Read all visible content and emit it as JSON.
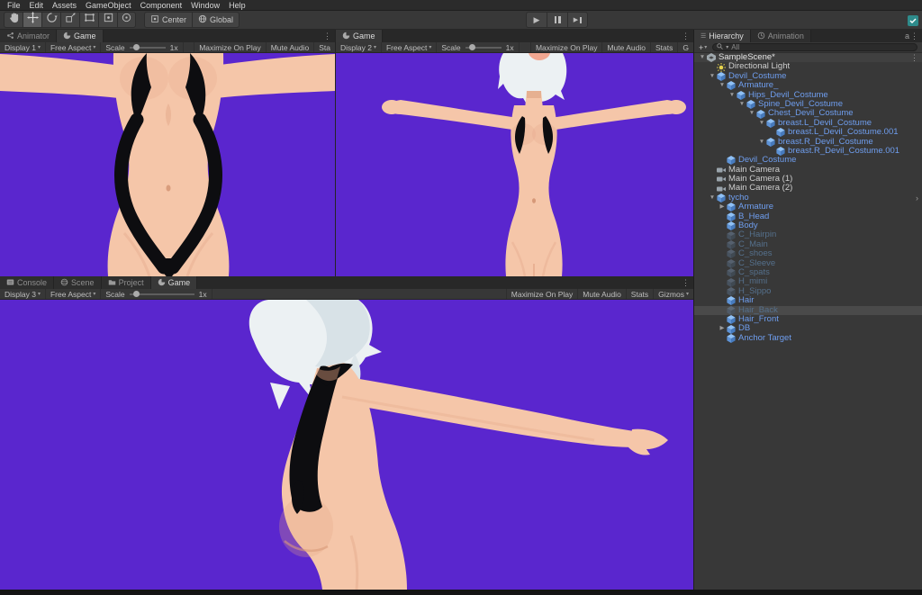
{
  "colors": {
    "viewport_bg": "#5A26CE",
    "skin": "#F5C6A9",
    "skin_shade": "#E2A486",
    "hair": "#ECF1F3",
    "costume": "#0D0D10",
    "prefab_blue": "#6F9EEF",
    "disabled_item": "#55708C",
    "selection_row": "#4A4A4A"
  },
  "icons": {
    "kebab": "⋮",
    "caret": "▾",
    "arrow_open": "▼",
    "arrow_closed": "▶",
    "plus": "+",
    "play": "▶",
    "chevron": "›",
    "hamburger": "☰"
  },
  "menu_bar": {
    "items": [
      "File",
      "Edit",
      "Assets",
      "GameObject",
      "Component",
      "Window",
      "Help"
    ]
  },
  "toolbar": {
    "center_label": "Center",
    "global_label": "Global"
  },
  "panel1": {
    "tab_animator": "Animator",
    "tab_game": "Game",
    "display": "Display 1",
    "aspect": "Free Aspect",
    "scale_label": "Scale",
    "scale_value": "1x",
    "maximize": "Maximize On Play",
    "mute": "Mute Audio",
    "stats": "Sta"
  },
  "panel2": {
    "tab_game": "Game",
    "display": "Display 2",
    "aspect": "Free Aspect",
    "scale_label": "Scale",
    "scale_value": "1x",
    "maximize": "Maximize On Play",
    "mute": "Mute Audio",
    "stats": "Stats",
    "gizmos": "G"
  },
  "panel3": {
    "tab_console": "Console",
    "tab_scene": "Scene",
    "tab_project": "Project",
    "tab_game": "Game",
    "display": "Display 3",
    "aspect": "Free Aspect",
    "scale_label": "Scale",
    "scale_value": "1x",
    "maximize": "Maximize On Play",
    "mute": "Mute Audio",
    "stats": "Stats",
    "gizmos": "Gizmos"
  },
  "hierarchy": {
    "tab_hierarchy": "Hierarchy",
    "tab_animation": "Animation",
    "corner_label": "a",
    "search_text": "All",
    "rows": [
      {
        "label": "SampleScene*",
        "depth": 0,
        "arrow": "open",
        "icon": "scene",
        "cls": "header",
        "trailing": "kebab"
      },
      {
        "label": "Directional Light",
        "depth": 1,
        "arrow": "",
        "icon": "light",
        "cls": "normal"
      },
      {
        "label": "Devil_Costume",
        "depth": 1,
        "arrow": "open",
        "icon": "prefab",
        "cls": "prefab"
      },
      {
        "label": "Armature_",
        "depth": 2,
        "arrow": "open",
        "icon": "cube",
        "cls": "prefab"
      },
      {
        "label": "Hips_Devil_Costume",
        "depth": 3,
        "arrow": "open",
        "icon": "cube",
        "cls": "prefab"
      },
      {
        "label": "Spine_Devil_Costume",
        "depth": 4,
        "arrow": "open",
        "icon": "cube",
        "cls": "prefab"
      },
      {
        "label": "Chest_Devil_Costume",
        "depth": 5,
        "arrow": "open",
        "icon": "cube",
        "cls": "prefab"
      },
      {
        "label": "breast.L_Devil_Costume",
        "depth": 6,
        "arrow": "open",
        "icon": "cube",
        "cls": "prefab"
      },
      {
        "label": "breast.L_Devil_Costume.001",
        "depth": 7,
        "arrow": "",
        "icon": "cube",
        "cls": "prefab"
      },
      {
        "label": "breast.R_Devil_Costume",
        "depth": 6,
        "arrow": "open",
        "icon": "cube",
        "cls": "prefab"
      },
      {
        "label": "breast.R_Devil_Costume.001",
        "depth": 7,
        "arrow": "",
        "icon": "cube",
        "cls": "prefab"
      },
      {
        "label": "Devil_Costume",
        "depth": 2,
        "arrow": "",
        "icon": "cube",
        "cls": "prefab"
      },
      {
        "label": "Main Camera",
        "depth": 1,
        "arrow": "",
        "icon": "camera",
        "cls": "normal"
      },
      {
        "label": "Main Camera (1)",
        "depth": 1,
        "arrow": "",
        "icon": "camera",
        "cls": "normal"
      },
      {
        "label": "Main Camera (2)",
        "depth": 1,
        "arrow": "",
        "icon": "camera",
        "cls": "normal"
      },
      {
        "label": "tycho",
        "depth": 1,
        "arrow": "open",
        "icon": "prefab",
        "cls": "prefab",
        "trailing": "chevron"
      },
      {
        "label": "Armature",
        "depth": 2,
        "arrow": "closed",
        "icon": "cube",
        "cls": "prefab"
      },
      {
        "label": "B_Head",
        "depth": 2,
        "arrow": "",
        "icon": "cube",
        "cls": "prefab"
      },
      {
        "label": "Body",
        "depth": 2,
        "arrow": "",
        "icon": "cube",
        "cls": "prefab"
      },
      {
        "label": "C_Hairpin",
        "depth": 2,
        "arrow": "",
        "icon": "cube",
        "cls": "muted"
      },
      {
        "label": "C_Main",
        "depth": 2,
        "arrow": "",
        "icon": "cube",
        "cls": "muted"
      },
      {
        "label": "C_shoes",
        "depth": 2,
        "arrow": "",
        "icon": "cube",
        "cls": "muted"
      },
      {
        "label": "C_Sleeve",
        "depth": 2,
        "arrow": "",
        "icon": "cube",
        "cls": "muted"
      },
      {
        "label": "C_spats",
        "depth": 2,
        "arrow": "",
        "icon": "cube",
        "cls": "muted"
      },
      {
        "label": "H_mimi",
        "depth": 2,
        "arrow": "",
        "icon": "cube",
        "cls": "muted"
      },
      {
        "label": "H_Sippo",
        "depth": 2,
        "arrow": "",
        "icon": "cube",
        "cls": "muted"
      },
      {
        "label": "Hair",
        "depth": 2,
        "arrow": "",
        "icon": "cube",
        "cls": "prefab"
      },
      {
        "label": "Hair_Back",
        "depth": 2,
        "arrow": "",
        "icon": "cube",
        "cls": "muted",
        "selected": true
      },
      {
        "label": "Hair_Front",
        "depth": 2,
        "arrow": "",
        "icon": "cube",
        "cls": "prefab"
      },
      {
        "label": "DB",
        "depth": 2,
        "arrow": "closed",
        "icon": "cube",
        "cls": "prefab"
      },
      {
        "label": "Anchor Target",
        "depth": 2,
        "arrow": "",
        "icon": "cube",
        "cls": "prefab"
      }
    ]
  }
}
